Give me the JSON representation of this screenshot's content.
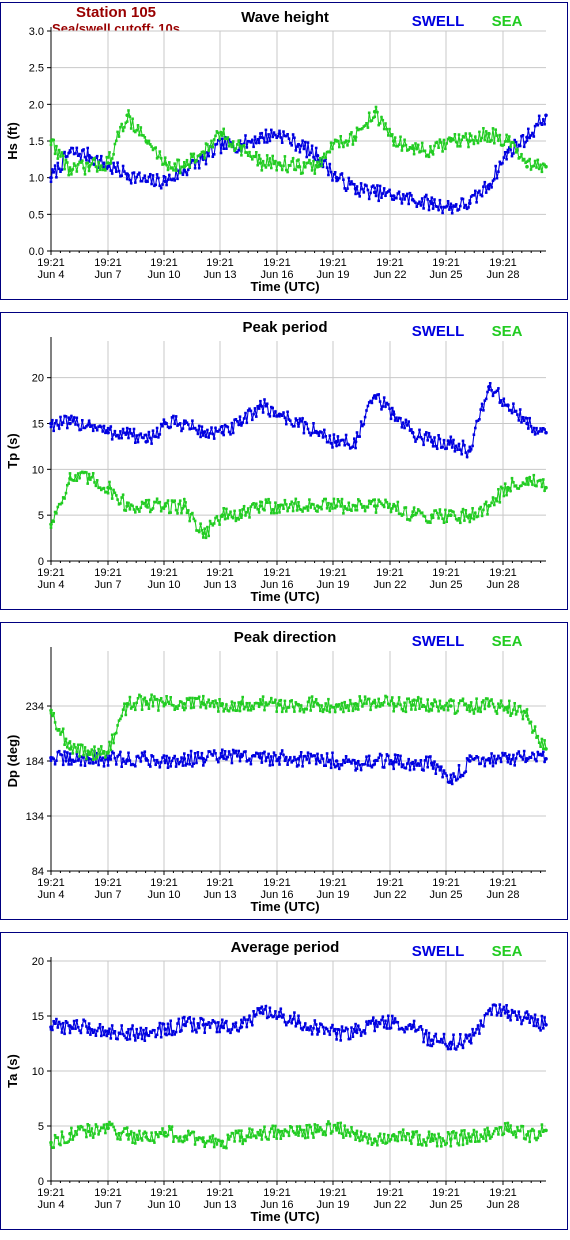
{
  "station": {
    "name": "Station 105",
    "cutoff": "Sea/swell cutoff: 10s"
  },
  "legend": {
    "swell": "SWELL",
    "sea": "SEA"
  },
  "colors": {
    "swell": "#0000e0",
    "sea": "#22cc22",
    "frame": "#000080",
    "grid": "#c8c8c8",
    "station": "#990000"
  },
  "x_axis": {
    "label": "Time (UTC)",
    "tick_times": [
      "19:21",
      "19:21",
      "19:21",
      "19:21",
      "19:21",
      "19:21",
      "19:21",
      "19:21",
      "19:21"
    ],
    "tick_dates": [
      "Jun 4",
      "Jun 7",
      "Jun 10",
      "Jun 13",
      "Jun 16",
      "Jun 19",
      "Jun 22",
      "Jun 25",
      "Jun 28"
    ]
  },
  "chart_data": [
    {
      "type": "line",
      "title": "Wave height",
      "ylabel": "Hs (ft)",
      "ylim": [
        0,
        3
      ],
      "yticks": [
        "0.0",
        "0.5",
        "1.0",
        "1.5",
        "2.0",
        "2.5",
        "3.0"
      ],
      "grid": true,
      "x": [
        "Jun 4",
        "Jun 5",
        "Jun 6",
        "Jun 7",
        "Jun 8",
        "Jun 9",
        "Jun 10",
        "Jun 11",
        "Jun 12",
        "Jun 13",
        "Jun 14",
        "Jun 15",
        "Jun 16",
        "Jun 17",
        "Jun 18",
        "Jun 19",
        "Jun 20",
        "Jun 21",
        "Jun 22",
        "Jun 23",
        "Jun 24",
        "Jun 25",
        "Jun 26",
        "Jun 27",
        "Jun 28",
        "Jun 29",
        "Jun 30"
      ],
      "series": [
        {
          "name": "SWELL",
          "values": [
            1.0,
            1.35,
            1.3,
            1.15,
            1.05,
            0.95,
            0.95,
            1.1,
            1.25,
            1.45,
            1.45,
            1.55,
            1.6,
            1.45,
            1.3,
            1.0,
            0.85,
            0.8,
            0.75,
            0.7,
            0.65,
            0.6,
            0.65,
            0.9,
            1.35,
            1.55,
            1.85
          ]
        },
        {
          "name": "SEA",
          "values": [
            1.5,
            1.1,
            1.15,
            1.2,
            1.85,
            1.5,
            1.2,
            1.15,
            1.35,
            1.6,
            1.4,
            1.2,
            1.2,
            1.15,
            1.15,
            1.5,
            1.55,
            1.9,
            1.5,
            1.4,
            1.35,
            1.5,
            1.5,
            1.6,
            1.5,
            1.15,
            1.15
          ]
        }
      ]
    },
    {
      "type": "line",
      "title": "Peak period",
      "ylabel": "Tp (s)",
      "ylim": [
        0,
        24
      ],
      "yticks": [
        "0",
        "5",
        "10",
        "15",
        "20"
      ],
      "grid": true,
      "x": [
        "Jun 4",
        "Jun 5",
        "Jun 6",
        "Jun 7",
        "Jun 8",
        "Jun 9",
        "Jun 10",
        "Jun 11",
        "Jun 12",
        "Jun 13",
        "Jun 14",
        "Jun 15",
        "Jun 16",
        "Jun 17",
        "Jun 18",
        "Jun 19",
        "Jun 20",
        "Jun 21",
        "Jun 22",
        "Jun 23",
        "Jun 24",
        "Jun 25",
        "Jun 26",
        "Jun 27",
        "Jun 28",
        "Jun 29",
        "Jun 30"
      ],
      "series": [
        {
          "name": "SWELL",
          "values": [
            15,
            15,
            15,
            14,
            14,
            13,
            15,
            15,
            14,
            14,
            15,
            17,
            16,
            15,
            14,
            13,
            13,
            18,
            16,
            14,
            13,
            13,
            12,
            19,
            17,
            15,
            14
          ]
        },
        {
          "name": "SEA",
          "values": [
            4,
            9,
            9,
            8,
            6,
            6,
            6,
            6,
            3,
            5,
            5,
            6,
            6,
            6,
            6,
            6,
            6,
            6,
            6,
            5,
            5,
            5,
            5,
            6,
            8,
            9,
            8
          ]
        }
      ]
    },
    {
      "type": "line",
      "title": "Peak direction",
      "ylabel": "Dp (deg)",
      "ylim": [
        84,
        284
      ],
      "yticks": [
        "84",
        "134",
        "184",
        "234"
      ],
      "grid": true,
      "x": [
        "Jun 4",
        "Jun 5",
        "Jun 6",
        "Jun 7",
        "Jun 8",
        "Jun 9",
        "Jun 10",
        "Jun 11",
        "Jun 12",
        "Jun 13",
        "Jun 14",
        "Jun 15",
        "Jun 16",
        "Jun 17",
        "Jun 18",
        "Jun 19",
        "Jun 20",
        "Jun 21",
        "Jun 22",
        "Jun 23",
        "Jun 24",
        "Jun 25",
        "Jun 26",
        "Jun 27",
        "Jun 28",
        "Jun 29",
        "Jun 30"
      ],
      "series": [
        {
          "name": "SWELL",
          "values": [
            187,
            185,
            186,
            186,
            185,
            186,
            184,
            186,
            186,
            188,
            188,
            187,
            187,
            186,
            186,
            184,
            182,
            184,
            183,
            182,
            182,
            165,
            184,
            186,
            186,
            186,
            186
          ]
        },
        {
          "name": "SEA",
          "values": [
            230,
            195,
            192,
            192,
            236,
            238,
            236,
            236,
            236,
            236,
            236,
            236,
            235,
            235,
            236,
            235,
            236,
            237,
            236,
            235,
            236,
            234,
            234,
            234,
            233,
            225,
            195
          ]
        }
      ]
    },
    {
      "type": "line",
      "title": "Average period",
      "ylabel": "Ta (s)",
      "ylim": [
        0,
        20
      ],
      "yticks": [
        "0",
        "5",
        "10",
        "15",
        "20"
      ],
      "grid": true,
      "x": [
        "Jun 4",
        "Jun 5",
        "Jun 6",
        "Jun 7",
        "Jun 8",
        "Jun 9",
        "Jun 10",
        "Jun 11",
        "Jun 12",
        "Jun 13",
        "Jun 14",
        "Jun 15",
        "Jun 16",
        "Jun 17",
        "Jun 18",
        "Jun 19",
        "Jun 20",
        "Jun 21",
        "Jun 22",
        "Jun 23",
        "Jun 24",
        "Jun 25",
        "Jun 26",
        "Jun 27",
        "Jun 28",
        "Jun 29",
        "Jun 30"
      ],
      "series": [
        {
          "name": "SWELL",
          "values": [
            14.0,
            14.1,
            13.9,
            13.6,
            13.5,
            13.4,
            13.8,
            14.2,
            14.2,
            14.0,
            14.0,
            15.3,
            15.0,
            14.5,
            13.8,
            13.4,
            13.6,
            14.3,
            14.4,
            14.0,
            12.8,
            12.6,
            12.7,
            15.5,
            15.4,
            14.8,
            14.2
          ]
        },
        {
          "name": "SEA",
          "values": [
            3.5,
            4.3,
            4.5,
            4.8,
            4.2,
            4.0,
            4.4,
            4.0,
            3.6,
            3.6,
            4.0,
            4.2,
            4.5,
            4.4,
            4.6,
            4.8,
            4.3,
            3.8,
            4.2,
            4.0,
            3.8,
            3.8,
            4.0,
            4.2,
            4.6,
            4.2,
            4.6
          ]
        }
      ]
    }
  ]
}
